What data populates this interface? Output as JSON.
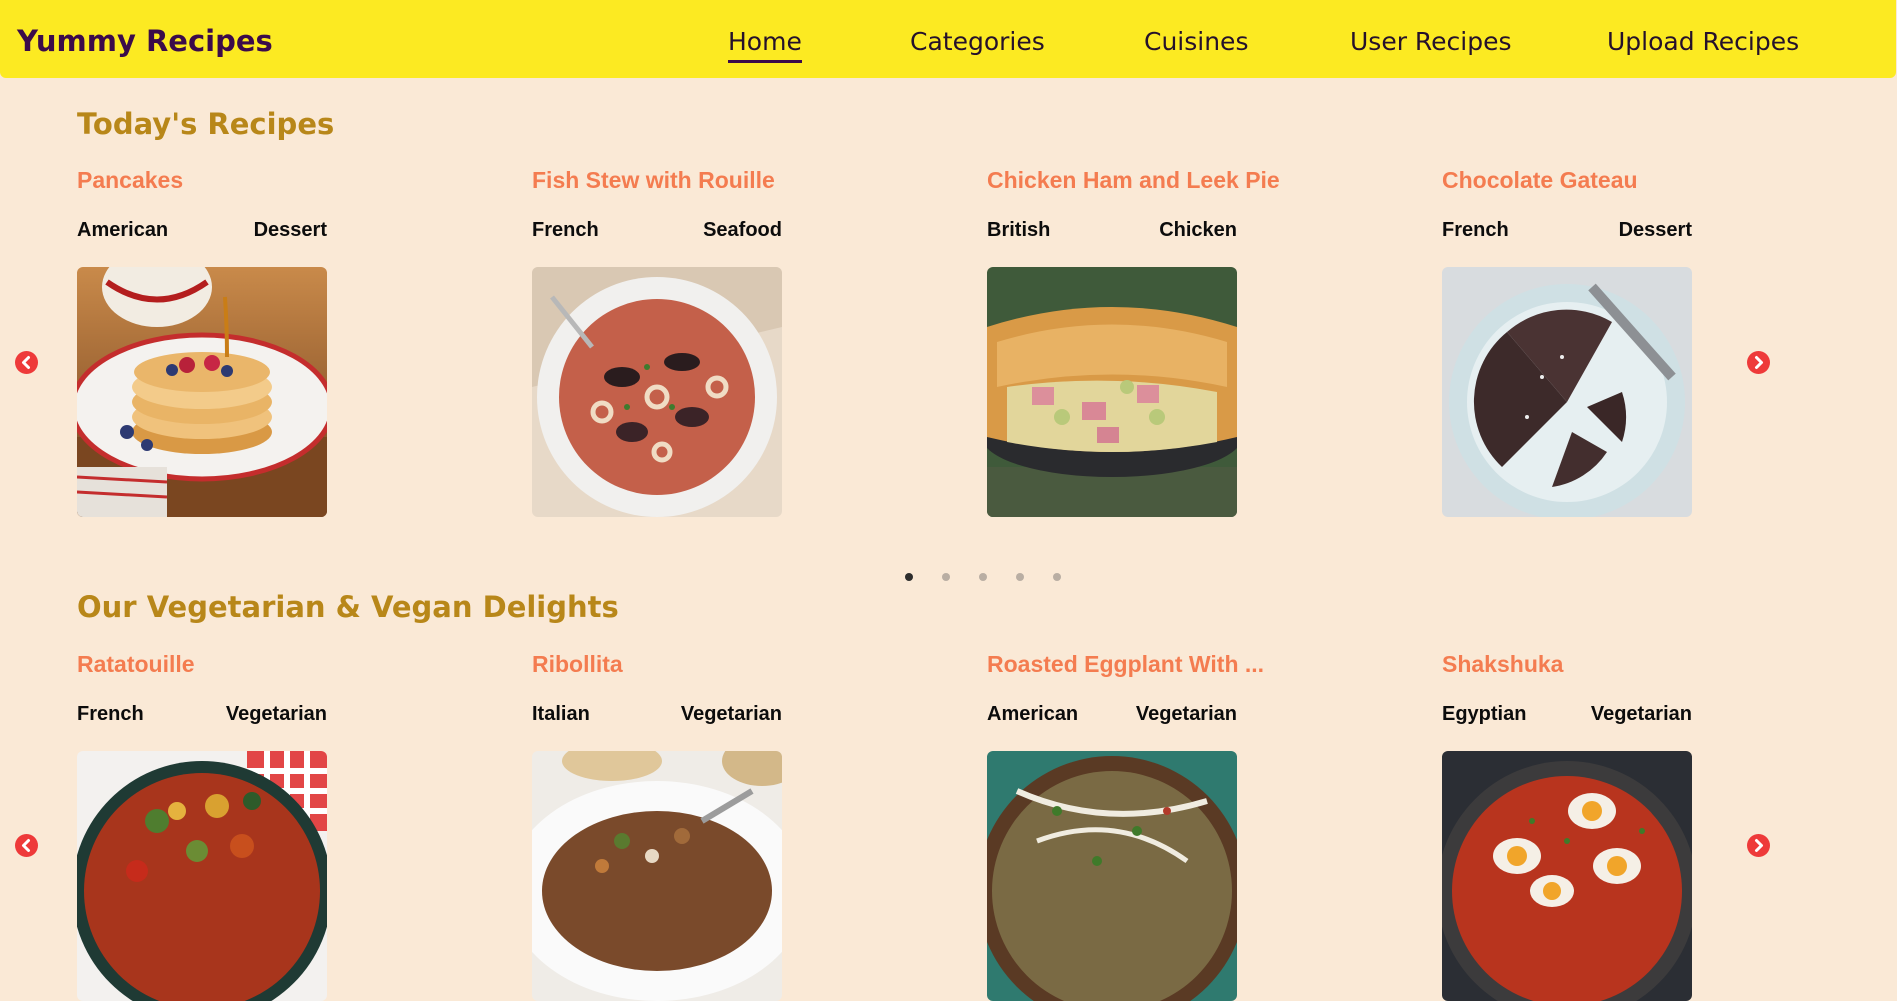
{
  "brand": "Yummy Recipes",
  "nav": [
    "Home",
    "Categories",
    "Cuisines",
    "User Recipes",
    "Upload Recipes"
  ],
  "sections": [
    {
      "title": "Today's Recipes",
      "cards": [
        {
          "title": "Pancakes",
          "cuisine": "American",
          "category": "Dessert",
          "image": "pancakes-photo"
        },
        {
          "title": "Fish Stew with Rouille",
          "cuisine": "French",
          "category": "Seafood",
          "image": "fish-stew-photo"
        },
        {
          "title": "Chicken Ham and Leek Pie",
          "cuisine": "British",
          "category": "Chicken",
          "image": "pie-photo"
        },
        {
          "title": "Chocolate Gateau",
          "cuisine": "French",
          "category": "Dessert",
          "image": "chocolate-gateau-photo"
        }
      ]
    },
    {
      "title": "Our Vegetarian & Vegan Delights",
      "cards": [
        {
          "title": "Ratatouille",
          "cuisine": "French",
          "category": "Vegetarian",
          "image": "ratatouille-photo"
        },
        {
          "title": "Ribollita",
          "cuisine": "Italian",
          "category": "Vegetarian",
          "image": "ribollita-photo"
        },
        {
          "title": "Roasted Eggplant With ...",
          "cuisine": "American",
          "category": "Vegetarian",
          "image": "roasted-eggplant-photo"
        },
        {
          "title": "Shakshuka",
          "cuisine": "Egyptian",
          "category": "Vegetarian",
          "image": "shakshuka-photo"
        }
      ]
    }
  ],
  "carousel_pages": 5,
  "carousel_active": 1,
  "colors": {
    "navbar": "#fcea22",
    "background": "#fae9d6",
    "brand": "#3b0b4a",
    "section_title": "#b88719",
    "card_title": "#f47c50",
    "arrow": "#ee3a3a"
  },
  "icons": {
    "prev": "chevron-left-circle-icon",
    "next": "chevron-right-circle-icon"
  }
}
